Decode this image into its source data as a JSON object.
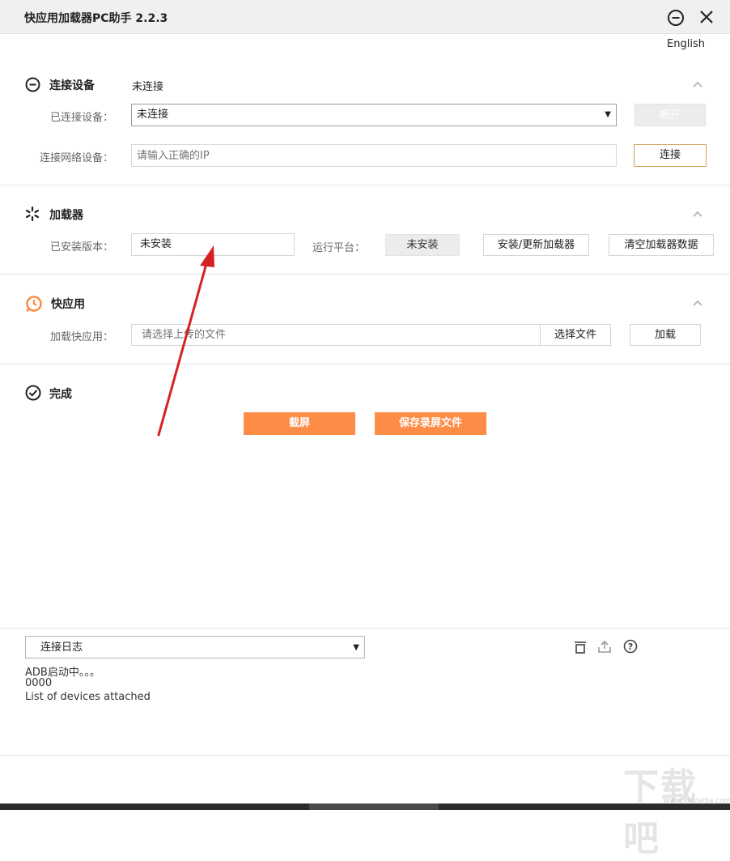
{
  "app": {
    "title": "快应用加载器PC助手 2.2.3",
    "language": "English",
    "accent_color": "#fd8c47"
  },
  "connect": {
    "title": "连接设备",
    "status": "未连接",
    "connected_label": "已连接设备：",
    "connected_value": "未连接",
    "disconnect_button": "断开",
    "network_label": "连接网络设备：",
    "network_placeholder": "请输入正确的IP",
    "connect_button": "连接"
  },
  "loader": {
    "title": "加载器",
    "installed_label": "已安装版本：",
    "installed_value": "未安装",
    "platform_label": "运行平台：",
    "platform_value": "未安装",
    "install_button": "安装/更新加载器",
    "clear_button": "清空加载器数据"
  },
  "quickapp": {
    "title": "快应用",
    "load_label": "加载快应用：",
    "file_placeholder": "请选择上传的文件",
    "choose_button": "选择文件",
    "load_button": "加载"
  },
  "done": {
    "title": "完成",
    "screenshot_button": "截屏",
    "save_recording_button": "保存录屏文件"
  },
  "log": {
    "selected": "连接日志",
    "lines": [
      "ADB启动中。。。",
      "0000",
      "List of devices attached"
    ]
  },
  "watermark": {
    "text": "下载吧",
    "url": "www.xiazaiba.com"
  },
  "annotation": {
    "arrow_color": "#d42222"
  }
}
